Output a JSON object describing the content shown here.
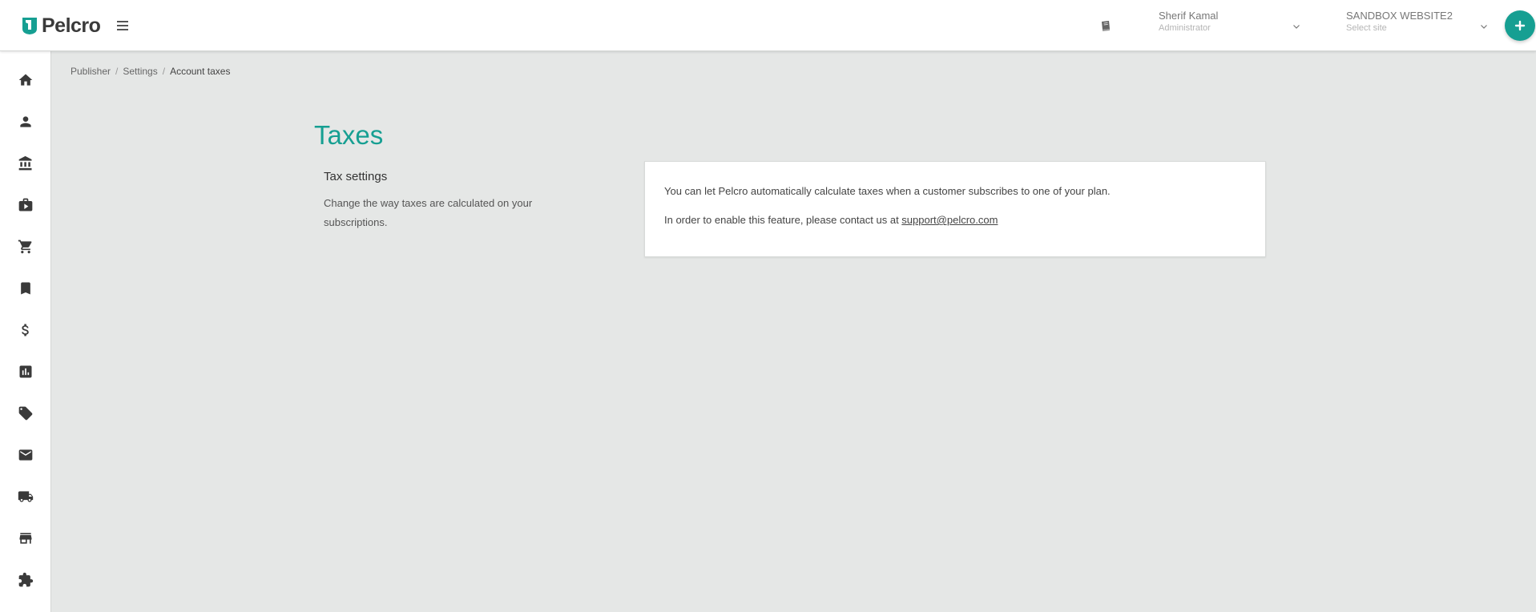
{
  "brand": {
    "name": "Pelcro",
    "accent_color": "#169f92"
  },
  "header": {
    "menu_icon": "hamburger-icon",
    "docs_icon": "book-icon",
    "user": {
      "name": "Sherif Kamal",
      "role": "Administrator"
    },
    "site": {
      "name": "SANDBOX WEBSITE2",
      "placeholder": "Select site"
    },
    "add_icon": "plus-icon"
  },
  "sidebar": {
    "items": [
      {
        "name": "home",
        "icon": "home-icon"
      },
      {
        "name": "customers",
        "icon": "person-icon"
      },
      {
        "name": "bank",
        "icon": "bank-icon"
      },
      {
        "name": "products",
        "icon": "briefcase-icon"
      },
      {
        "name": "orders",
        "icon": "cart-icon"
      },
      {
        "name": "bookmarks",
        "icon": "bookmark-icon"
      },
      {
        "name": "billing",
        "icon": "dollar-icon"
      },
      {
        "name": "reports",
        "icon": "chart-icon"
      },
      {
        "name": "coupons",
        "icon": "ticket-icon"
      },
      {
        "name": "emails",
        "icon": "mail-icon"
      },
      {
        "name": "shipping",
        "icon": "truck-icon"
      },
      {
        "name": "store",
        "icon": "store-icon"
      },
      {
        "name": "integrations",
        "icon": "puzzle-icon"
      }
    ]
  },
  "breadcrumb": {
    "items": [
      "Publisher",
      "Settings",
      "Account taxes"
    ],
    "separator": "/"
  },
  "page": {
    "title": "Taxes",
    "section_title": "Tax settings",
    "section_description": "Change the way taxes are calculated on your subscriptions.",
    "card": {
      "line1": "You can let Pelcro automatically calculate taxes when a customer subscribes to one of your plan.",
      "line2_prefix": "In order to enable this feature, please contact us at ",
      "support_email": "support@pelcro.com"
    }
  }
}
